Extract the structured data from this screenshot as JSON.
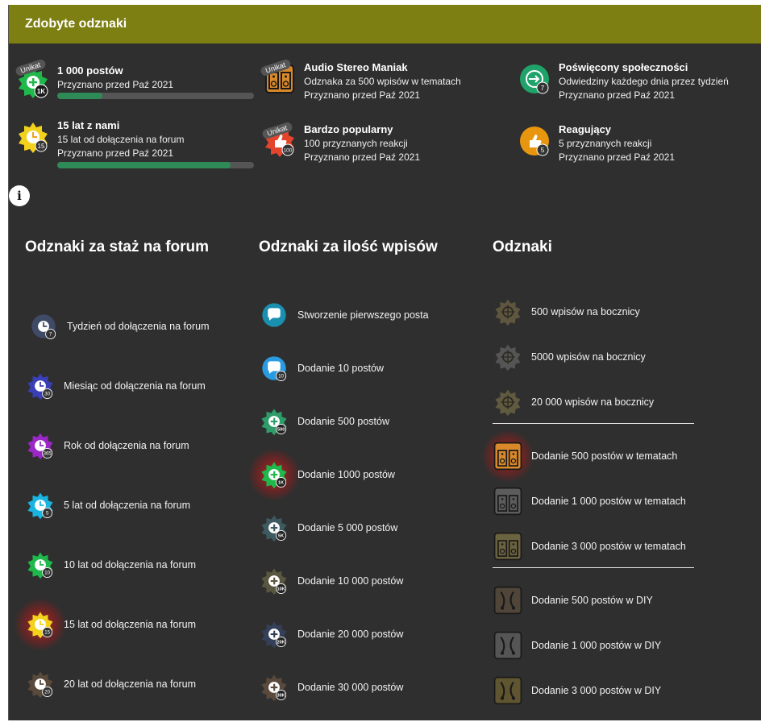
{
  "header": {
    "title": "Zdobyte odznaki"
  },
  "earned": [
    {
      "title": "1 000 postów",
      "line2": "Przyznano przed Paź 2021",
      "unique": "Unikat",
      "badge_text": "1K",
      "progress": 0.23
    },
    {
      "title": "Audio Stereo Maniak",
      "line2": "Odznaka za 500 wpisów w tematach",
      "line3": "Przyznano przed Paź 2021",
      "unique": "Unikat"
    },
    {
      "title": "Poświęcony społeczności",
      "line2": "Odwiedziny każdego dnia przez tydzień",
      "line3": "Przyznano przed Paź 2021",
      "badge_text": "7"
    },
    {
      "title": "15 lat z nami",
      "line2": "15 lat od dołączenia na forum",
      "line3": "Przyznano przed Paź 2021",
      "badge_text": "15",
      "progress": 0.88
    },
    {
      "title": "Bardzo popularny",
      "line2": "100 przyznanych reakcji",
      "line3": "Przyznano przed Paź 2021",
      "unique": "Unikat",
      "badge_text": "100"
    },
    {
      "title": "Reagujący",
      "line2": "5 przyznanych reakcji",
      "line3": "Przyznano przed Paź 2021",
      "badge_text": "5"
    }
  ],
  "info_icon": "i",
  "columns": {
    "staz": {
      "title": "Odznaki za staż na forum",
      "items": [
        {
          "label": "Tydzień od dołączenia na forum",
          "badge": "7",
          "color": "#3f4a66"
        },
        {
          "label": "Miesiąc od dołączenia na forum",
          "badge": "30",
          "color": "#3a3fb8"
        },
        {
          "label": "Rok od dołączenia na forum",
          "badge": "365",
          "color": "#9b27c6"
        },
        {
          "label": "5 lat od dołączenia na forum",
          "badge": "5",
          "color": "#19b5e0"
        },
        {
          "label": "10 lat od dołączenia na forum",
          "badge": "10",
          "color": "#1fb84a"
        },
        {
          "label": "15 lat od dołączenia na forum",
          "badge": "15",
          "color": "#f2d21c"
        },
        {
          "label": "20 lat od dołączenia na forum",
          "badge": "20",
          "color": "#5a4a3c"
        }
      ]
    },
    "wpisy": {
      "title": "Odznaki za ilość wpisów",
      "items": [
        {
          "label": "Stworzenie pierwszego posta",
          "badge": "",
          "color": "#1a8fb0"
        },
        {
          "label": "Dodanie 10 postów",
          "badge": "10",
          "color": "#2a9be0"
        },
        {
          "label": "Dodanie 500 postów",
          "badge": "500",
          "color": "#2e9d6a"
        },
        {
          "label": "Dodanie 1000 postów",
          "badge": "1K",
          "color": "#1fb84a"
        },
        {
          "label": "Dodanie 5 000 postów",
          "badge": "5K",
          "color": "#3c5a60"
        },
        {
          "label": "Dodanie 10 000 postów",
          "badge": "10K",
          "color": "#5a5740"
        },
        {
          "label": "Dodanie 20 000 postów",
          "badge": "20K",
          "color": "#34405a"
        },
        {
          "label": "Dodanie 30 000 postów",
          "badge": "30K",
          "color": "#5a4a3c"
        }
      ]
    },
    "odznaki": {
      "title": "Odznaki",
      "group1": [
        {
          "label": "500 wpisów na bocznicy",
          "color": "#5f5640"
        },
        {
          "label": "5000 wpisów na bocznicy",
          "color": "#555555"
        },
        {
          "label": "20 000 wpisów na bocznicy",
          "color": "#5f5a40"
        }
      ],
      "group2": [
        {
          "label": "Dodanie 500 postów w tematach",
          "color": "#d9892a"
        },
        {
          "label": "Dodanie 1 000 postów w tematach",
          "color": "#5c5c5c"
        },
        {
          "label": "Dodanie 3 000 postów w tematach",
          "color": "#6b623f"
        }
      ],
      "group3": [
        {
          "label": "Dodanie 500 postów w DIY",
          "color": "#4f4538"
        },
        {
          "label": "Dodanie 1 000 postów w DIY",
          "color": "#555555"
        },
        {
          "label": "Dodanie 3 000 postów w DIY",
          "color": "#5f5530"
        }
      ]
    }
  }
}
